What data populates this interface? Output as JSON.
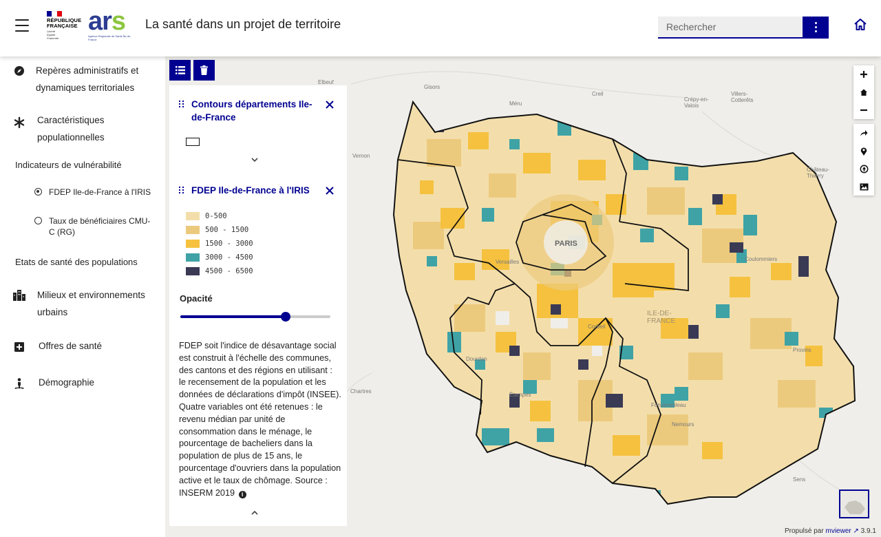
{
  "header": {
    "logo_rf_lines": [
      "RÉPUBLIQUE",
      "FRANÇAISE"
    ],
    "logo_rf_motto": [
      "Liberté",
      "Égalité",
      "Fraternité"
    ],
    "logo_ars": "ars",
    "logo_ars_tag": "Agence Régionale de Santé Île-de-France",
    "title": "La santé dans un projet de territoire",
    "search_placeholder": "Rechercher"
  },
  "sidebar": {
    "items": [
      {
        "label": "Repères administratifs et dynamiques territoriales",
        "icon": "compass-icon"
      },
      {
        "label": "Caractéristiques populationnelles",
        "icon": "asterisk-icon"
      },
      {
        "label": "Milieux et environnements urbains",
        "icon": "buildings-icon"
      },
      {
        "label": "Offres de santé",
        "icon": "plus-square-icon"
      },
      {
        "label": "Démographie",
        "icon": "person-icon"
      }
    ],
    "subheadings": {
      "vulnerability": "Indicateurs de vulnérabilité",
      "health_states": "Etats de santé des populations"
    },
    "radios": [
      {
        "label": "FDEP Ile-de-France à l'IRIS",
        "checked": true
      },
      {
        "label": "Taux de bénéficiaires CMU-C (RG)",
        "checked": false
      }
    ]
  },
  "panel": {
    "layer1": {
      "title": "Contours départements Ile-de-France"
    },
    "layer2": {
      "title": "FDEP Ile-de-France à l'IRIS",
      "legend": [
        {
          "label": "0-500",
          "color": "#f3deab"
        },
        {
          "label": "500 - 1500",
          "color": "#ecca7d"
        },
        {
          "label": "1500 - 3000",
          "color": "#f5c13f"
        },
        {
          "label": "3000 - 4500",
          "color": "#3fa3a6"
        },
        {
          "label": "4500 - 6500",
          "color": "#3a3a55"
        }
      ],
      "opacity_label": "Opacité",
      "opacity_value": 0.7,
      "description": "FDEP soit l'indice de désavantage social est construit à l'échelle des communes, des cantons et des régions en utilisant : le recensement de la population et les données de déclarations d'impôt (INSEE). Quatre variables ont été retenues : le revenu médian par unité de consommation dans le ménage, le pourcentage de bacheliers dans la population de plus de 15 ans, le pourcentage d'ouvriers dans la population active et le taux de chômage. Source : INSERM 2019"
    }
  },
  "map": {
    "places": [
      "Elbeuf",
      "Gisors",
      "Méru",
      "Creil",
      "Crépy-en-Valois",
      "Villers-Cotterêts",
      "Vernon",
      "Château-Thierry",
      "PARIS",
      "ILE-DE-FRANCE",
      "Chartres",
      "Sens",
      "Fontainebleau",
      "Nemours",
      "Versailles",
      "Coulommiers",
      "Provins",
      "Étampes",
      "Dourdan",
      "Corbeil"
    ]
  },
  "footer": {
    "powered": "Propulsé par",
    "link": "mviewer",
    "version": "3.9.1"
  }
}
